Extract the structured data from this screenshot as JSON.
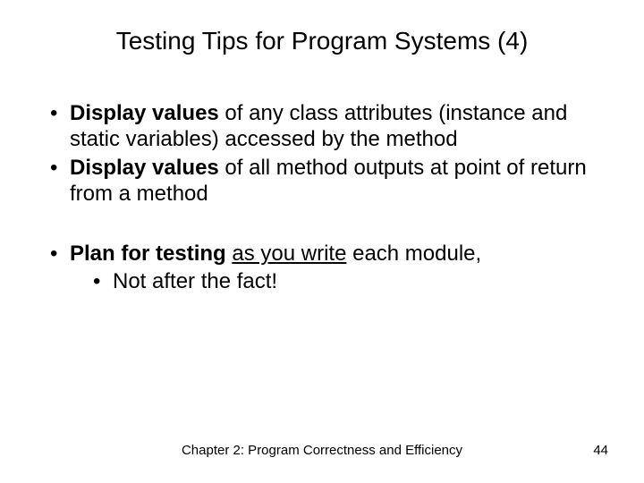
{
  "slide": {
    "title": "Testing Tips for Program Systems (4)",
    "bullets": {
      "b1_bold": "Display values",
      "b1_rest": " of any class attributes (instance and static variables) accessed by the method",
      "b2_bold": "Display values",
      "b2_rest": " of all method outputs at point of return from a method",
      "b3_bold": "Plan for testing ",
      "b3_underline": "as you write",
      "b3_rest": " each module,",
      "b3_sub": "Not after the fact!"
    },
    "footer": {
      "chapter": "Chapter 2: Program Correctness and Efficiency",
      "page": "44"
    }
  }
}
